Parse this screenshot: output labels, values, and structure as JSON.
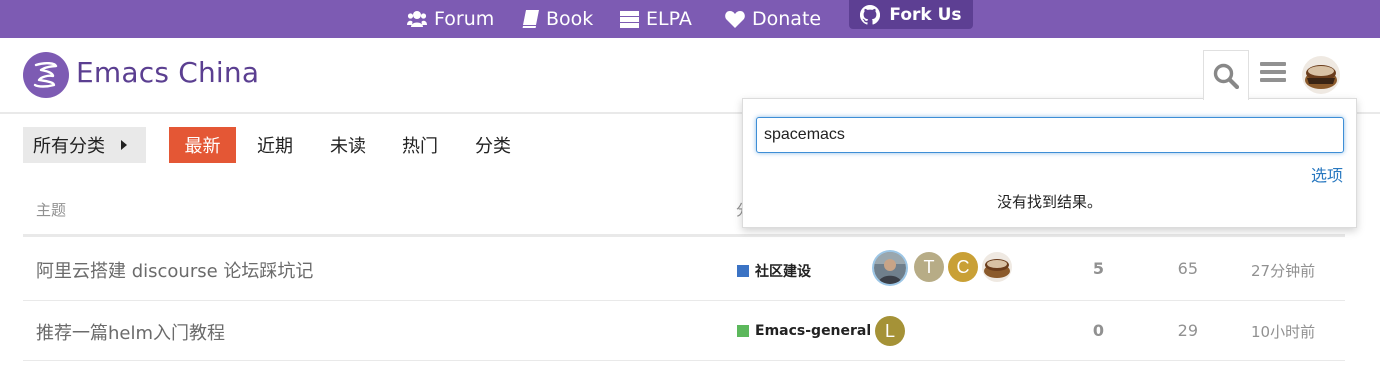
{
  "top_nav": {
    "items": [
      {
        "label": "Forum",
        "icon": "users-icon"
      },
      {
        "label": "Book",
        "icon": "book-icon"
      },
      {
        "label": "ELPA",
        "icon": "server-icon"
      },
      {
        "label": "Donate",
        "icon": "heart-icon"
      }
    ],
    "fork": {
      "label": "Fork Us",
      "icon": "github-icon"
    }
  },
  "header": {
    "site_title": "Emacs China",
    "logo_icon": "emacs-logo-icon",
    "search_icon": "search-icon",
    "menu_icon": "hamburger-icon"
  },
  "search": {
    "value": "spacemacs",
    "options_label": "选项",
    "no_results": "没有找到结果。"
  },
  "category_nav": {
    "dropdown_label": "所有分类",
    "tabs": [
      {
        "label": "最新",
        "active": true
      },
      {
        "label": "近期",
        "active": false
      },
      {
        "label": "未读",
        "active": false
      },
      {
        "label": "热门",
        "active": false
      },
      {
        "label": "分类",
        "active": false
      }
    ]
  },
  "topic_list": {
    "columns": [
      "主题",
      "分"
    ],
    "rows": [
      {
        "title": "阿里云搭建 discourse 论坛踩坑记",
        "category": "社区建设",
        "category_color": "#3b73c4",
        "posters": [
          {
            "type": "photo"
          },
          {
            "letter": "T",
            "color": "#b7ac86"
          },
          {
            "letter": "C",
            "color": "#c9a036"
          },
          {
            "type": "cake"
          }
        ],
        "replies": "5",
        "views": "65",
        "activity": "27分钟前"
      },
      {
        "title": "推荐一篇helm入门教程",
        "category": "Emacs-general",
        "category_color": "#5cb85c",
        "posters": [
          {
            "letter": "L",
            "color": "#a59237"
          }
        ],
        "replies": "0",
        "views": "29",
        "activity": "10小时前"
      }
    ]
  },
  "colors": {
    "brand_purple": "#7d5bb3",
    "fork_purple": "#5d3f93",
    "active_tab": "#e45735",
    "link_blue": "#2878c0"
  }
}
